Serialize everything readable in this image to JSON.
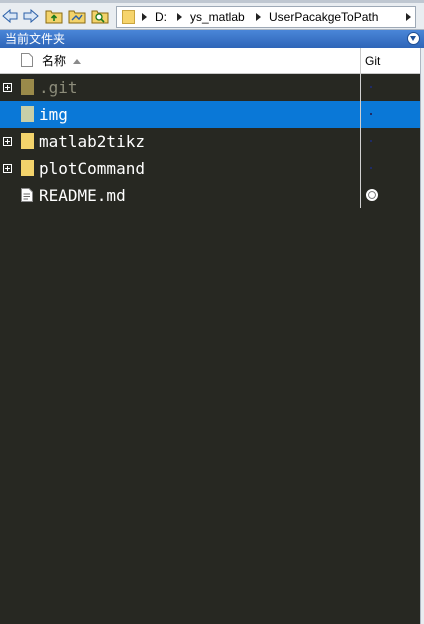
{
  "toolbar": {
    "buttons": [
      {
        "name": "back-button",
        "icon": "arrow-left-icon"
      },
      {
        "name": "forward-button",
        "icon": "arrow-right-icon"
      },
      {
        "name": "up-folder-button",
        "icon": "folder-up-icon"
      },
      {
        "name": "browse-folder-button",
        "icon": "folder-browse-icon"
      },
      {
        "name": "find-files-button",
        "icon": "folder-search-icon"
      }
    ],
    "address": [
      "D:",
      "ys_matlab",
      "UserPacakgeToPath"
    ]
  },
  "panel": {
    "title": "当前文件夹"
  },
  "columns": {
    "name": "名称",
    "git": "Git"
  },
  "files": [
    {
      "name": ".git",
      "type": "folder",
      "expandable": true,
      "selected": false,
      "dimmed": true,
      "git_status": "dot"
    },
    {
      "name": "img",
      "type": "folder",
      "expandable": false,
      "selected": true,
      "dimmed": false,
      "git_status": "dot"
    },
    {
      "name": "matlab2tikz",
      "type": "folder",
      "expandable": true,
      "selected": false,
      "dimmed": false,
      "git_status": "dot"
    },
    {
      "name": "plotCommand",
      "type": "folder",
      "expandable": true,
      "selected": false,
      "dimmed": false,
      "git_status": "dot"
    },
    {
      "name": "README.md",
      "type": "file",
      "expandable": false,
      "selected": false,
      "dimmed": false,
      "git_status": "modified"
    }
  ],
  "colors": {
    "background": "#272822",
    "selection": "#0a78d7",
    "title_bar": "#3a74c8",
    "text": "#ffffff",
    "dimmed_text": "#8c8c7a",
    "folder": "#f3d36b",
    "folder_dimmed": "#9a8a4a"
  }
}
